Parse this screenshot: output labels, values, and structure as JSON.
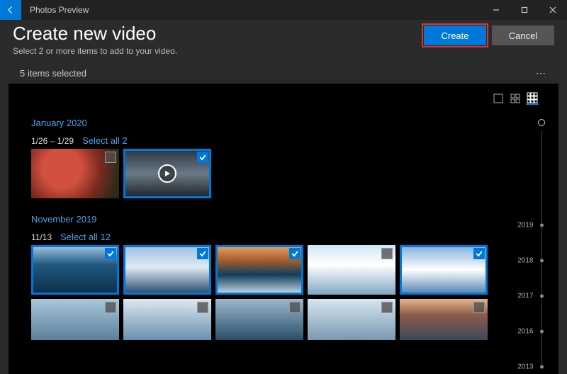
{
  "app_title": "Photos Preview",
  "header": {
    "title": "Create new video",
    "subtitle": "Select 2 or more items to add to your video.",
    "create_label": "Create",
    "cancel_label": "Cancel"
  },
  "status": {
    "selection_text": "5 items selected"
  },
  "groups": [
    {
      "month": "January 2020",
      "date_range": "1/26 – 1/29",
      "select_all_label": "Select all 2",
      "items": [
        {
          "name": "apple-photo",
          "selected": false,
          "is_video": false,
          "fill": "apple"
        },
        {
          "name": "waterfall-video",
          "selected": true,
          "is_video": true,
          "fill": "water"
        }
      ]
    },
    {
      "month": "November 2019",
      "date_range": "11/13",
      "select_all_label": "Select all 12",
      "items_row1": [
        {
          "name": "iceberg-1",
          "selected": true,
          "fill": "ice-a"
        },
        {
          "name": "iceberg-2",
          "selected": true,
          "fill": "ice-b"
        },
        {
          "name": "iceberg-3",
          "selected": true,
          "fill": "ice-c"
        },
        {
          "name": "iceberg-4",
          "selected": false,
          "fill": "ice-d"
        },
        {
          "name": "iceberg-5",
          "selected": true,
          "fill": "ice-e"
        }
      ],
      "items_row2": [
        {
          "name": "iceberg-6",
          "selected": false,
          "fill": "ice-f"
        },
        {
          "name": "iceberg-7",
          "selected": false,
          "fill": "ice-g"
        },
        {
          "name": "iceberg-8",
          "selected": false,
          "fill": "ice-h"
        },
        {
          "name": "iceberg-9",
          "selected": false,
          "fill": "ice-i"
        },
        {
          "name": "iceberg-10",
          "selected": false,
          "fill": "ice-j"
        }
      ]
    }
  ],
  "timeline_years": [
    "2019",
    "2018",
    "2017",
    "2016",
    "2013"
  ]
}
